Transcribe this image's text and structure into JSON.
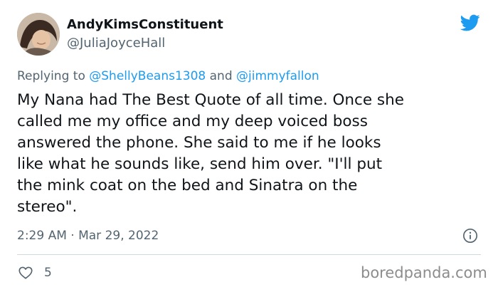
{
  "author": {
    "display_name": "AndyKimsConstituent",
    "handle": "@JuliaJoyceHall"
  },
  "reply": {
    "prefix": "Replying to",
    "mention_1": "@ShellyBeans1308",
    "connector": "and",
    "mention_2": "@jimmyfallon"
  },
  "tweet": {
    "text": "My Nana had The Best Quote of all time. Once she\ncalled me my office and my deep voiced boss\nanswered the phone.  She said to me if he looks\nlike what he sounds like, send him over.  \"I'll put\nthe mink coat on the bed and Sinatra on the\nstereo\".",
    "timestamp": "2:29 AM · Mar 29, 2022"
  },
  "actions": {
    "like_count": "5"
  },
  "watermark": "boredpanda.com",
  "colors": {
    "brand": "#1d9bf0",
    "text": "#0f1419",
    "secondary": "#536471",
    "divider": "#cfd9de"
  },
  "icons": [
    "avatar",
    "twitter-bird-icon",
    "info-icon",
    "heart-icon"
  ]
}
